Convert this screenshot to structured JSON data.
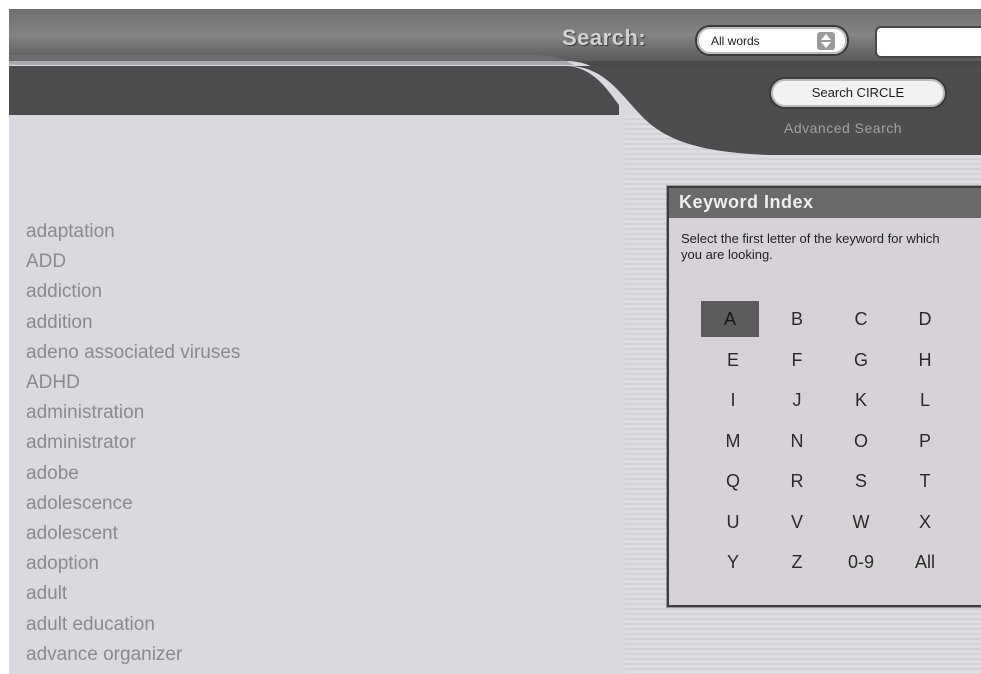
{
  "header": {
    "search_label": "Search:",
    "search_mode": "All words",
    "search_input_value": "",
    "search_button": "Search CIRCLE",
    "advanced_search": "Advanced Search"
  },
  "keywords": [
    "adaptation",
    "ADD",
    "addiction",
    "addition",
    "adeno associated viruses",
    "ADHD",
    "administration",
    "administrator",
    "adobe",
    "adolescence",
    "adolescent",
    "adoption",
    "adult",
    "adult education",
    "advance organizer"
  ],
  "keyword_index": {
    "title": "Keyword Index",
    "instructions": "Select the first letter of the keyword for which you are looking.",
    "letters": [
      "A",
      "B",
      "C",
      "D",
      "E",
      "F",
      "G",
      "H",
      "I",
      "J",
      "K",
      "L",
      "M",
      "N",
      "O",
      "P",
      "Q",
      "R",
      "S",
      "T",
      "U",
      "V",
      "W",
      "X",
      "Y",
      "Z",
      "0-9",
      "All"
    ],
    "selected": "A"
  },
  "colors": {
    "header_dark": "#4a484b",
    "page_background": "#dcd8df",
    "keyword_text": "#8c8a8e",
    "selected_letter_bg": "#5d5b5e"
  }
}
